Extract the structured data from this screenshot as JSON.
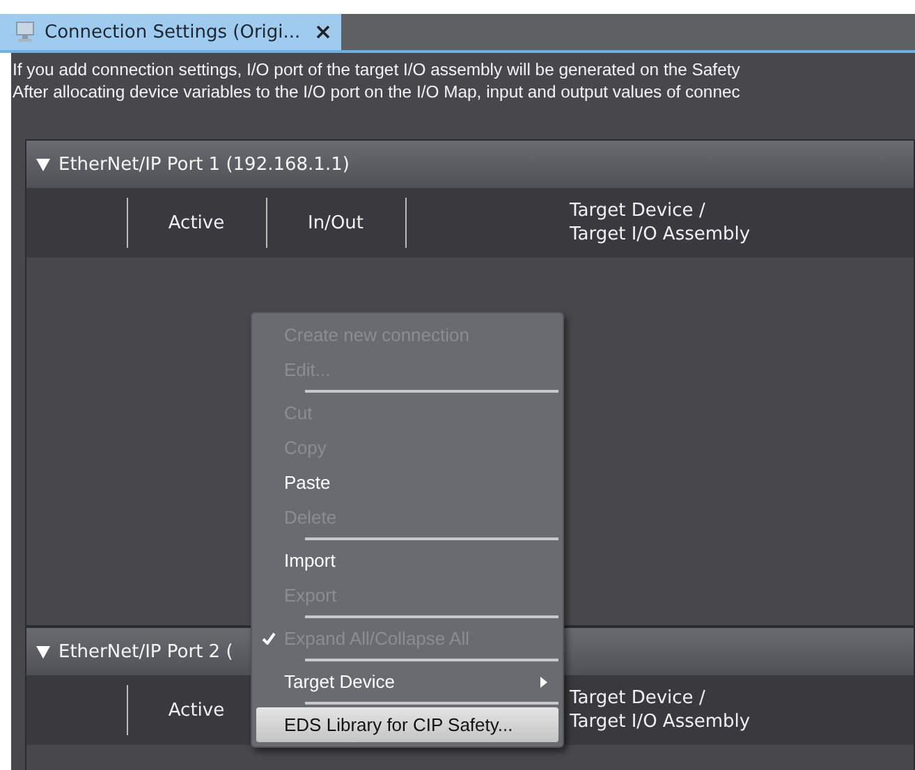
{
  "tab": {
    "title": "Connection Settings (Origi...",
    "selected": true
  },
  "info_lines": [
    "If you add connection settings, I/O port of the target I/O assembly will be generated on the Safety",
    "After allocating device variables to the I/O port on the I/O Map, input and output values of connec"
  ],
  "ports": [
    {
      "title": "EtherNet/IP Port 1 (192.168.1.1)",
      "expanded": true,
      "columns": [
        {
          "kind": "active",
          "label": "Active"
        },
        {
          "kind": "inout",
          "label": "In/Out"
        },
        {
          "kind": "target",
          "label": "Target Device /\nTarget I/O Assembly"
        }
      ]
    },
    {
      "title": "EtherNet/IP Port 2 (",
      "expanded": true,
      "columns": [
        {
          "kind": "active",
          "label": "Active"
        },
        {
          "kind": "target",
          "label": "Target Device /\nTarget I/O Assembly"
        }
      ]
    }
  ],
  "context_menu": [
    {
      "kind": "item",
      "label": "Create new connection",
      "disabled": true,
      "checked": false,
      "submenu": false,
      "selected": false
    },
    {
      "kind": "item",
      "label": "Edit...",
      "disabled": true,
      "checked": false,
      "submenu": false,
      "selected": false
    },
    {
      "kind": "separator"
    },
    {
      "kind": "item",
      "label": "Cut",
      "disabled": true,
      "checked": false,
      "submenu": false,
      "selected": false
    },
    {
      "kind": "item",
      "label": "Copy",
      "disabled": true,
      "checked": false,
      "submenu": false,
      "selected": false
    },
    {
      "kind": "item",
      "label": "Paste",
      "disabled": false,
      "checked": false,
      "submenu": false,
      "selected": false
    },
    {
      "kind": "item",
      "label": "Delete",
      "disabled": true,
      "checked": false,
      "submenu": false,
      "selected": false
    },
    {
      "kind": "separator"
    },
    {
      "kind": "item",
      "label": "Import",
      "disabled": false,
      "checked": false,
      "submenu": false,
      "selected": false
    },
    {
      "kind": "item",
      "label": "Export",
      "disabled": true,
      "checked": false,
      "submenu": false,
      "selected": false
    },
    {
      "kind": "separator"
    },
    {
      "kind": "item",
      "label": "Expand All/Collapse All",
      "disabled": true,
      "checked": true,
      "submenu": false,
      "selected": false
    },
    {
      "kind": "separator"
    },
    {
      "kind": "item",
      "label": "Target Device",
      "disabled": false,
      "checked": false,
      "submenu": true,
      "selected": false
    },
    {
      "kind": "separator"
    },
    {
      "kind": "item",
      "label": "EDS Library for CIP Safety...",
      "disabled": false,
      "checked": false,
      "submenu": false,
      "selected": true
    }
  ]
}
